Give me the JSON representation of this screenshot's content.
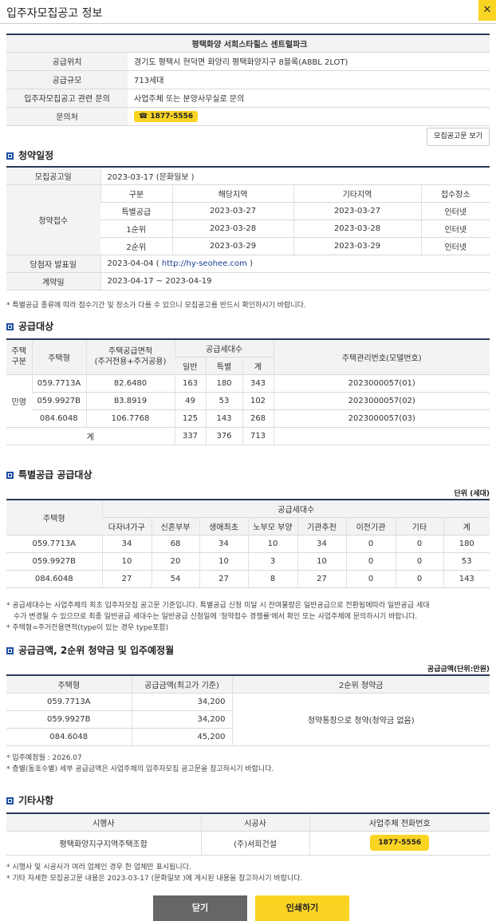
{
  "window": {
    "title": "입주자모집공고 정보"
  },
  "info": {
    "header": "평택화양 서희스타힐스 센트럴파크",
    "rows": [
      {
        "label": "공급위치",
        "value": "경기도 평택시 현덕면 화양리 평택화양지구 8블록(A8BL 2LOT)"
      },
      {
        "label": "공급규모",
        "value": "713세대"
      },
      {
        "label": "입주자모집공고 관련 문의",
        "value": "사업주체 또는 분양사무실로 문의"
      }
    ],
    "contact_label": "문의처",
    "contact_phone": "☎ 1877-5556",
    "view_button": "모집공고문 보기"
  },
  "schedule": {
    "title": "청약일정",
    "announce_label": "모집공고일",
    "announce_value": "2023-03-17 (문화일보 )",
    "apply_label": "청약접수",
    "headers": [
      "구분",
      "해당지역",
      "기타지역",
      "접수장소"
    ],
    "rows": [
      [
        "특별공급",
        "2023-03-27",
        "2023-03-27",
        "인터넷"
      ],
      [
        "1순위",
        "2023-03-28",
        "2023-03-28",
        "인터넷"
      ],
      [
        "2순위",
        "2023-03-29",
        "2023-03-29",
        "인터넷"
      ]
    ],
    "winner_label": "당첨자 발표일",
    "winner_date": "2023-04-04 (",
    "winner_link": "http://hy-seohee.com",
    "winner_close": ")",
    "contract_label": "계약일",
    "contract_value": "2023-04-17 ~ 2023-04-19",
    "note": "* 특별공급 종류에 따라 접수기간 및 장소가 다를 수 있으니 모집공고를 반드시 확인하시기 바랍니다."
  },
  "supply": {
    "title": "공급대상",
    "h_type_cat": "주택\n구분",
    "h_type": "주택형",
    "h_area": "주택공급면적",
    "h_area_sub": "(주거전용+주거공용)",
    "h_units": "공급세대수",
    "h_general": "일반",
    "h_special": "특별",
    "h_total": "계",
    "h_mgmt": "주택관리번호(모델번호)",
    "category": "민영",
    "rows": [
      [
        "059.7713A",
        "82.6480",
        "163",
        "180",
        "343",
        "2023000057(01)"
      ],
      [
        "059.9927B",
        "83.8919",
        "49",
        "53",
        "102",
        "2023000057(02)"
      ],
      [
        "084.6048",
        "106.7768",
        "125",
        "143",
        "268",
        "2023000057(03)"
      ]
    ],
    "sum_label": "계",
    "sum": [
      "337",
      "376",
      "713"
    ]
  },
  "special": {
    "title": "특별공급 공급대상",
    "unit": "단위 (세대)",
    "h_type": "주택형",
    "h_units": "공급세대수",
    "headers": [
      "다자녀가구",
      "신혼부부",
      "생애최초",
      "노부모 부양",
      "기관추천",
      "이전기관",
      "기타",
      "계"
    ],
    "rows": [
      [
        "059.7713A",
        "34",
        "68",
        "34",
        "10",
        "34",
        "0",
        "0",
        "180"
      ],
      [
        "059.9927B",
        "10",
        "20",
        "10",
        "3",
        "10",
        "0",
        "0",
        "53"
      ],
      [
        "084.6048",
        "27",
        "54",
        "27",
        "8",
        "27",
        "0",
        "0",
        "143"
      ]
    ],
    "note1": "* 공급세대수는 사업주체의 최초 입주자모집 공고문 기준입니다. 특별공급 신청 미달 시 잔여물량은 일반공급으로 전환됨에따라 일반공급 세대",
    "note2": "수가 변경될 수 있으므로 최종 일반공급 세대수는 일반공급 신청일에 '청약접수 경쟁률'에서 확인 또는 사업주체에 문의하시기 바랍니다.",
    "note3": "* 주택형=주거전용면적(type이 있는 경우 type포함)"
  },
  "price": {
    "title": "공급금액, 2순위 청약금 및 입주예정월",
    "unit": "공급금액(단위:만원)",
    "h_type": "주택형",
    "h_price": "공급금액(최고가 기준)",
    "h_deposit": "2순위 청약금",
    "deposit_value": "청약통장으로 청약(청약금 없음)",
    "rows": [
      [
        "059.7713A",
        "34,200"
      ],
      [
        "059.9927B",
        "34,200"
      ],
      [
        "084.6048",
        "45,200"
      ]
    ],
    "note1": "* 입주예정월 : 2026.07",
    "note2": "* 층별(동호수별) 세부 공급금액은 사업주체의 입주자모집 공고문을 참고하시기 바랍니다."
  },
  "etc": {
    "title": "기타사항",
    "headers": [
      "시행사",
      "시공사",
      "사업주체 전화번호"
    ],
    "developer": "평택화양지구지역주택조합",
    "builder": "(주)서희건설",
    "phone": "1877-5556",
    "note1": "* 시행사 및 시공사가 여러 업체인 경우 한 업체만 표시됩니다.",
    "note2": "* 기타 자세한 모집공고문 내용은 2023-03-17 (문화일보 )에 게시된 내용을 참고하시기 바랍니다."
  },
  "buttons": {
    "close": "닫기",
    "print": "인쇄하기"
  },
  "icons": {
    "close": "close-icon"
  },
  "colors": {
    "accent": "#f9d423",
    "heading_border": "#2b3a57",
    "section_icon": "#1e4fa3",
    "close_button": "#666666"
  }
}
